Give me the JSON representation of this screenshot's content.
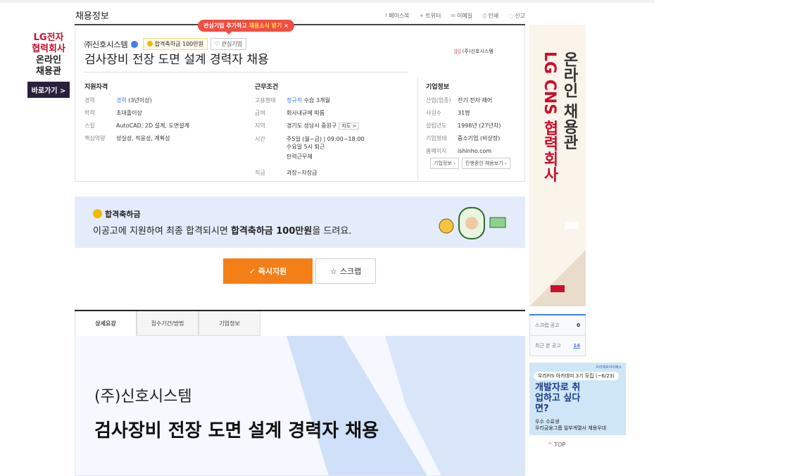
{
  "left_ad": {
    "line1": "LG전자",
    "line2": "협력회사",
    "line3": "온라인",
    "line4": "채용관",
    "button": "바로가기 >"
  },
  "header": {
    "title": "채용정보",
    "share": [
      {
        "icon": "facebook-icon",
        "label": "페이스북"
      },
      {
        "icon": "twitter-icon",
        "label": "트위터"
      },
      {
        "icon": "email-icon",
        "label": "이메일"
      },
      {
        "icon": "print-icon",
        "label": "인쇄"
      },
      {
        "icon": "report-icon",
        "label": "신고"
      }
    ]
  },
  "tooltip": {
    "text": "관심기업 추가하고 ",
    "highlight": "채용소식 받기",
    "close": "×"
  },
  "job": {
    "company": "㈜신호시스템",
    "bonus_badge": "합격축하금 100만원",
    "fav_label": "관심기업",
    "title": "검사장비 전장 도면 설계 경력자 채용",
    "logo_text": "(주)신호시스템"
  },
  "qual": {
    "heading": "지원자격",
    "rows": [
      {
        "k": "경력",
        "v1": "경력",
        "v2": " (3년이상)"
      },
      {
        "k": "학력",
        "v1": "초대졸이상",
        "v2": ""
      },
      {
        "k": "스킬",
        "v1": "",
        "v2": "AutoCAD, 2D 설계, 도면설계"
      },
      {
        "k": "핵심역량",
        "v1": "",
        "v2": "성실성, 적응성, 계획성"
      }
    ]
  },
  "cond": {
    "heading": "근무조건",
    "employ_k": "고용형태",
    "employ_v1": "정규직",
    "employ_v2": " 수습 3개월",
    "pay_k": "급여",
    "pay_v": "회사내규에 따름",
    "loc_k": "지역",
    "loc_v": "경기도 성남시 중원구",
    "map": "지도 >",
    "time_k": "시간",
    "time_v1": "주5일 (월~금) | 09:00~18:00",
    "time_v2": "수요일 5시 퇴근",
    "time_v3": "탄력근무제",
    "rank_k": "직급",
    "rank_v": "과장~차장급"
  },
  "corp": {
    "heading": "기업정보",
    "rows": [
      {
        "k": "산업(업종)",
        "v": "전기·전자·제어"
      },
      {
        "k": "사원수",
        "v": "31명"
      },
      {
        "k": "설립년도",
        "v": "1998년 (27년차)"
      },
      {
        "k": "기업형태",
        "v": "중소기업 (비상장)"
      },
      {
        "k": "홈페이지",
        "v": "ishinho.com"
      }
    ],
    "btn1": "기업정보",
    "btn2": "진행중인 채용보기"
  },
  "banner": {
    "heading": "합격축하금",
    "pre": "이공고에 지원하여 최종 합격되시면 ",
    "strong": "합격축하금 100만원",
    "post": "을 드려요."
  },
  "actions": {
    "apply": "✓ 즉시지원",
    "scrap": "스크랩"
  },
  "tabs": [
    "상세요강",
    "접수기간/방법",
    "기업정보"
  ],
  "detail": {
    "company": "(주)신호시스템",
    "title": "검사장비 전장 도면 설계 경력자 채용"
  },
  "right_ad": {
    "line1": "온라인 채용관",
    "line2": "LG CNS 협력회사"
  },
  "side": {
    "scrap_label": "스크랩 공고",
    "scrap_count": "0",
    "recent_label": "최근 본 공고",
    "recent_count": "14"
  },
  "ad2": {
    "brand": "우리에프아이에스",
    "pill": "우리FIS 아카데미 3기 모집 (~6/23)",
    "big": "개발자로 취업하고 싶다면?",
    "sm1": "우수 수료생",
    "sm2": "우리금융그룹 일부계열사 채용우대"
  },
  "top": "TOP"
}
